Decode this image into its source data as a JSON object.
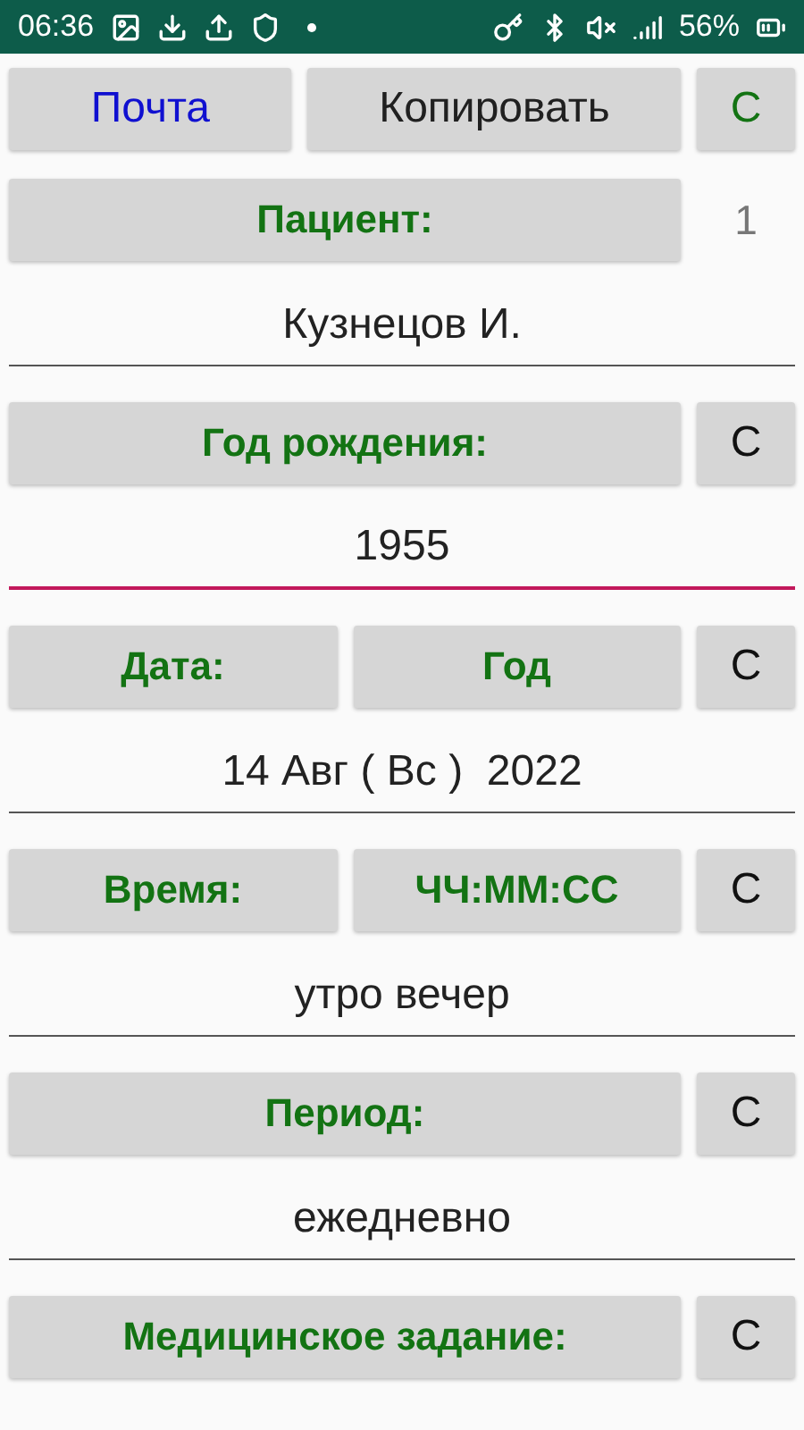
{
  "status_bar": {
    "time": "06:36",
    "battery": "56%"
  },
  "top_row": {
    "buttons": [
      {
        "label": "Почта",
        "color": "#1010d0"
      },
      {
        "label": "Копировать",
        "color": "#202020"
      }
    ],
    "side": {
      "kind": "button",
      "text": "С",
      "color": "#137313"
    }
  },
  "sections": [
    {
      "buttons": [
        {
          "label": "Пациент:",
          "color": "#137313"
        }
      ],
      "side": {
        "kind": "counter",
        "text": "1"
      },
      "field": {
        "value": "Кузнецов И.",
        "focused": false
      }
    },
    {
      "buttons": [
        {
          "label": "Год рождения:",
          "color": "#137313"
        }
      ],
      "side": {
        "kind": "button",
        "text": "С",
        "color": "#111111"
      },
      "field": {
        "value": "1955",
        "focused": true
      }
    },
    {
      "buttons": [
        {
          "label": "Дата:",
          "color": "#137313"
        },
        {
          "label": "Год",
          "color": "#137313"
        }
      ],
      "side": {
        "kind": "button",
        "text": "С",
        "color": "#111111"
      },
      "field": {
        "value": "14 Авг ( Вс )  2022",
        "focused": false
      }
    },
    {
      "buttons": [
        {
          "label": "Время:",
          "color": "#137313"
        },
        {
          "label": "ЧЧ:ММ:СС",
          "color": "#137313"
        }
      ],
      "side": {
        "kind": "button",
        "text": "С",
        "color": "#111111"
      },
      "field": {
        "value": "утро вечер",
        "focused": false
      }
    },
    {
      "buttons": [
        {
          "label": "Период:",
          "color": "#137313"
        }
      ],
      "side": {
        "kind": "button",
        "text": "С",
        "color": "#111111"
      },
      "field": {
        "value": "ежедневно",
        "focused": false
      }
    },
    {
      "buttons": [
        {
          "label": "Медицинское задание:",
          "color": "#137313"
        }
      ],
      "side": {
        "kind": "button",
        "text": "С",
        "color": "#111111"
      }
    }
  ]
}
